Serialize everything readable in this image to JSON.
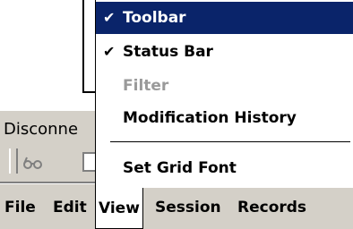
{
  "status": {
    "text": "Disconne"
  },
  "menubar": {
    "items": [
      {
        "label": "File"
      },
      {
        "label": "Edit"
      },
      {
        "label": "View"
      },
      {
        "label": "Session"
      },
      {
        "label": "Records"
      }
    ]
  },
  "view_menu": {
    "items": [
      {
        "label": "Toolbar",
        "checked": "✔"
      },
      {
        "label": "Status Bar",
        "checked": "✔"
      },
      {
        "label": "Filter"
      },
      {
        "label": "Modification History"
      },
      {
        "label": "Set Grid Font"
      }
    ]
  },
  "colors": {
    "highlight": "#0a246a",
    "menu_bg": "#ffffff",
    "chrome": "#d4d0c8",
    "disabled_text": "#9a9a9a"
  },
  "icons": [
    "grip-icon",
    "glasses-icon",
    "document-icon",
    "check-icon"
  ]
}
